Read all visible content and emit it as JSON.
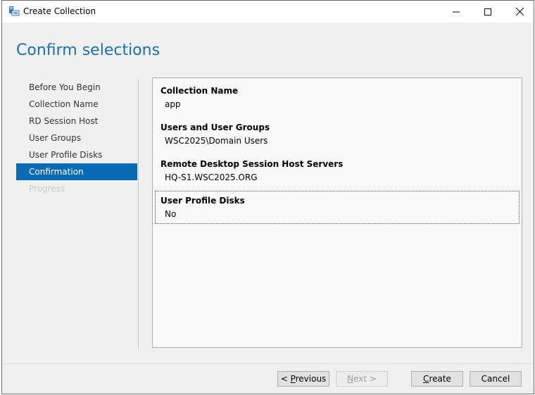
{
  "window": {
    "title": "Create Collection"
  },
  "page_title": "Confirm selections",
  "nav": {
    "items": [
      {
        "label": "Before You Begin",
        "state": "normal"
      },
      {
        "label": "Collection Name",
        "state": "normal"
      },
      {
        "label": "RD Session Host",
        "state": "normal"
      },
      {
        "label": "User Groups",
        "state": "normal"
      },
      {
        "label": "User Profile Disks",
        "state": "normal"
      },
      {
        "label": "Confirmation",
        "state": "active"
      },
      {
        "label": "Progress",
        "state": "disabled"
      }
    ]
  },
  "summary": {
    "collection_name": {
      "heading": "Collection Name",
      "value": "app"
    },
    "user_groups": {
      "heading": "Users and User Groups",
      "value": "WSC2025\\Domain Users"
    },
    "session_hosts": {
      "heading": "Remote Desktop Session Host Servers",
      "value": "HQ-S1.WSC2025.ORG"
    },
    "profile_disks": {
      "heading": "User Profile Disks",
      "value": "No"
    }
  },
  "buttons": {
    "previous": {
      "prefix": "< ",
      "accel": "P",
      "rest": "revious"
    },
    "next": {
      "accel": "N",
      "rest": "ext >"
    },
    "create": {
      "accel": "C",
      "rest": "reate"
    },
    "cancel": "Cancel"
  },
  "colors": {
    "accent": "#0a6bb5",
    "title": "#1e6fa8"
  }
}
